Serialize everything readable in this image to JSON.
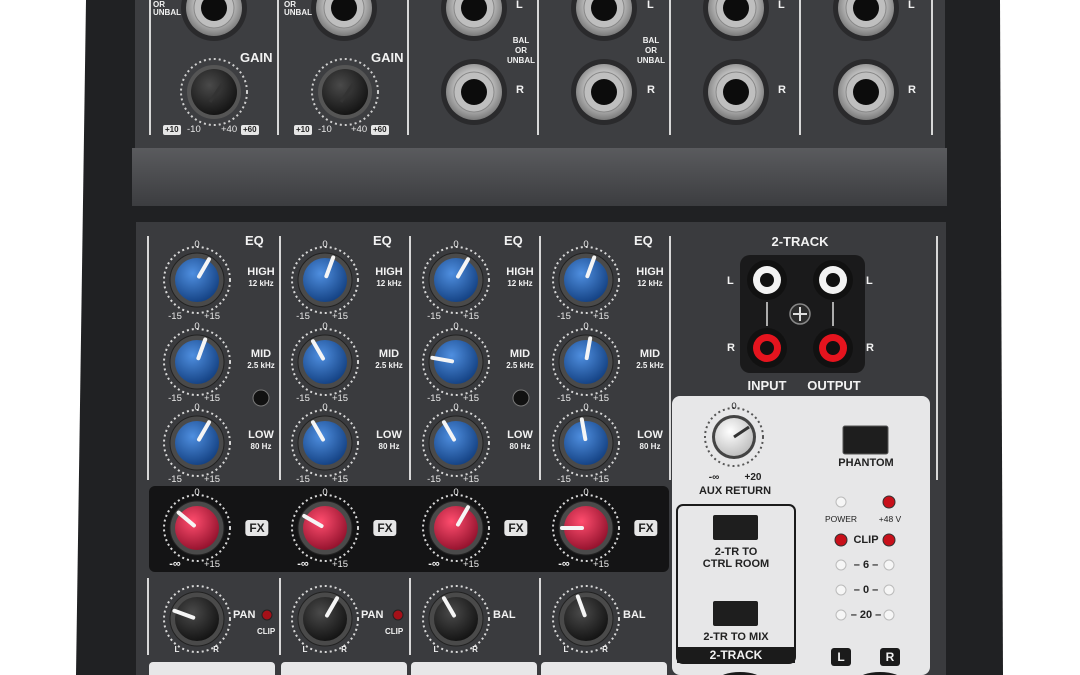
{
  "input_section": {
    "or_unbal": "OR\nUNBAL",
    "gain_label": "GAIN",
    "gain_ticks": {
      "left_pill": "+10",
      "left": "-10",
      "right": "+40",
      "right_pill": "+60"
    },
    "bal_or_unbal": "BAL\nOR\nUNBAL",
    "left": "L",
    "right": "R"
  },
  "channels": [
    {
      "id": "ch1",
      "eq": "EQ",
      "high": "HIGH",
      "high_freq": "12 kHz",
      "mid": "MID",
      "mid_freq": "2.5 kHz",
      "low": "LOW",
      "low_freq": "80 Hz",
      "minus": "-15",
      "plus": "+15",
      "zero": "0",
      "fx": "FX",
      "fx_min": "-∞",
      "fx_max": "+15",
      "pan": "PAN",
      "clip": "CLIP",
      "l": "L",
      "r": "R"
    },
    {
      "id": "ch2",
      "eq": "EQ",
      "high": "HIGH",
      "high_freq": "12 kHz",
      "mid": "MID",
      "mid_freq": "2.5 kHz",
      "low": "LOW",
      "low_freq": "80 Hz",
      "minus": "-15",
      "plus": "+15",
      "zero": "0",
      "fx": "FX",
      "fx_min": "-∞",
      "fx_max": "+15",
      "pan": "PAN",
      "clip": "CLIP",
      "l": "L",
      "r": "R"
    },
    {
      "id": "ch3",
      "eq": "EQ",
      "high": "HIGH",
      "high_freq": "12 kHz",
      "mid": "MID",
      "mid_freq": "2.5 kHz",
      "low": "LOW",
      "low_freq": "80 Hz",
      "minus": "-15",
      "plus": "+15",
      "zero": "0",
      "fx": "FX",
      "fx_min": "-∞",
      "fx_max": "+15",
      "bal": "BAL",
      "l": "L",
      "r": "R"
    },
    {
      "id": "ch4",
      "eq": "EQ",
      "high": "HIGH",
      "high_freq": "12 kHz",
      "mid": "MID",
      "mid_freq": "2.5 kHz",
      "low": "LOW",
      "low_freq": "80 Hz",
      "minus": "-15",
      "plus": "+15",
      "zero": "0",
      "fx": "FX",
      "fx_min": "-∞",
      "fx_max": "+15",
      "bal": "BAL",
      "l": "L",
      "r": "R"
    }
  ],
  "two_track": {
    "title": "2-TRACK",
    "l": "L",
    "r": "R",
    "input": "INPUT",
    "output": "OUTPUT"
  },
  "master": {
    "aux_zero": "0",
    "aux_min": "-∞",
    "aux_max": "+20",
    "aux_return": "AUX RETURN",
    "phantom": "PHANTOM",
    "power": "POWER",
    "plus48": "+48 V",
    "clip": "CLIP",
    "meter": [
      "6",
      "0",
      "20"
    ],
    "tr_to_ctrl": "2-TR TO\nCTRL ROOM",
    "tr_to_mix": "2-TR TO MIX",
    "two_track_label": "2-TRACK",
    "l_badge": "L",
    "r_badge": "R"
  },
  "colors": {
    "panel": "#3a3b3d",
    "eq_knob": "#1f5fae",
    "fx_knob": "#c21a3c",
    "pan_knob": "#2a2a2a",
    "led_red": "#d0101a"
  }
}
